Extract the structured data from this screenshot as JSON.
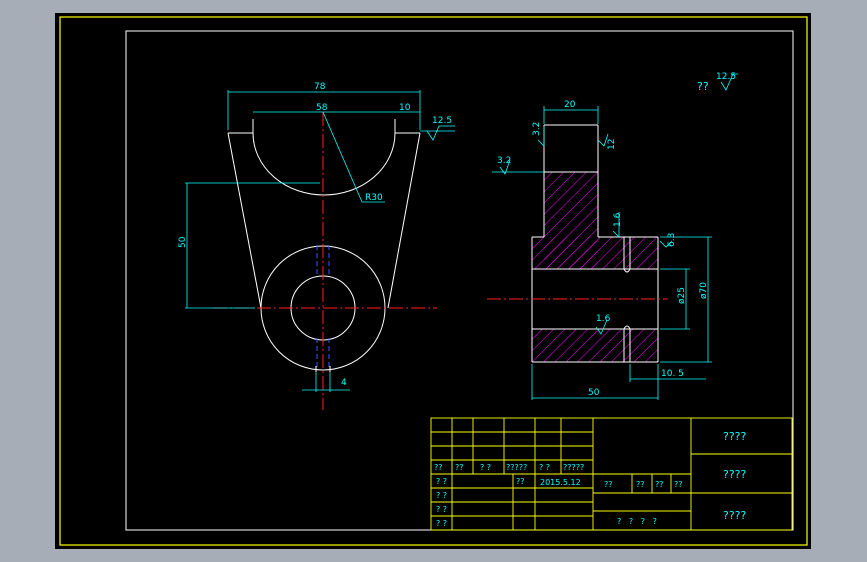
{
  "colors": {
    "background": "#000000",
    "frame": "#ffff00",
    "outline": "#ffffff",
    "dimension": "#00ffff",
    "centerline": "#ff0000",
    "hatch": "#ff00ff",
    "hidden": "#0000ff",
    "table_text": "#00ffff"
  },
  "front_view": {
    "dim_width": "78",
    "dim_arc_width": "58",
    "dim_side": "10",
    "dim_height": "50",
    "dim_radius": "R30",
    "dim_slot": "4",
    "roughness_top": "12.5"
  },
  "section_view": {
    "dim_shaft": "20",
    "dim_length": "50",
    "dim_offset": "10. 5",
    "dim_bore": "ø25",
    "dim_outer": "ø70",
    "rough_shaft_left": "3.2",
    "rough_shaft_right": "12",
    "rough_step": "3.2",
    "rough_face": "1.6",
    "rough_side": "6.3",
    "rough_bore": "1.6"
  },
  "general_roughness": {
    "label": "??",
    "value": "12.5"
  },
  "title_block": {
    "row_sign": [
      "??",
      "??",
      "? ?",
      "?????",
      "? ?",
      "?????"
    ],
    "designer_label": "? ?",
    "date_prefix": "??",
    "date": "2015.5.12",
    "stage_headers": [
      "??",
      "??",
      "??",
      "??"
    ],
    "row_labels": [
      "? ?",
      "? ?",
      "? ?"
    ],
    "scale_row": "?   ?   ?   ?",
    "right_cells": [
      "????",
      "????",
      "????"
    ]
  }
}
